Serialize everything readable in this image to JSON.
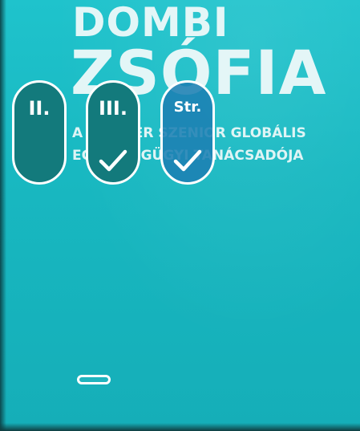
{
  "poster": {
    "line1": "DOMBI",
    "line2": "ZSÓFIA",
    "line3": "A RICHTER SZENIOR GLOBÁLIS",
    "line4": "EGÉSZSÉGÜGYI TANÁCSADÓJA"
  },
  "toggles": [
    {
      "label": "II.",
      "checked": false
    },
    {
      "label": "III.",
      "checked": true
    },
    {
      "label": "Str.",
      "checked": true
    }
  ],
  "colors": {
    "background": "#17b6bf",
    "pill_teal": "#137a7c",
    "pill_blue": "#1c7fb3",
    "outline": "#ffffff"
  },
  "icons": [
    "checkmark-icon",
    "drag-handle"
  ]
}
